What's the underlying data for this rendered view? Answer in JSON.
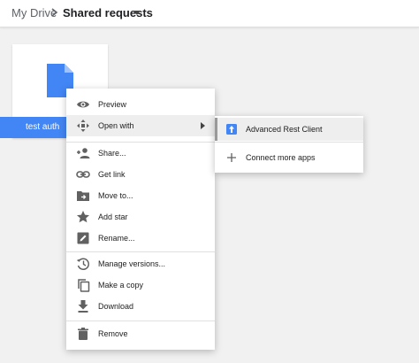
{
  "breadcrumb": {
    "root": "My Drive",
    "current": "Shared requests"
  },
  "file_tile": {
    "label": "test auth"
  },
  "context_menu": {
    "items": [
      {
        "label": "Preview",
        "icon": "eye-icon"
      },
      {
        "label": "Open with",
        "icon": "open-with-icon"
      },
      {
        "label": "Share...",
        "icon": "add-person-icon"
      },
      {
        "label": "Get link",
        "icon": "link-icon"
      },
      {
        "label": "Move to...",
        "icon": "move-folder-icon"
      },
      {
        "label": "Add star",
        "icon": "star-icon"
      },
      {
        "label": "Rename...",
        "icon": "pencil-icon"
      },
      {
        "label": "Manage versions...",
        "icon": "history-icon"
      },
      {
        "label": "Make a copy",
        "icon": "copy-icon"
      },
      {
        "label": "Download",
        "icon": "download-icon"
      },
      {
        "label": "Remove",
        "icon": "trash-icon"
      }
    ]
  },
  "open_with_submenu": {
    "items": [
      {
        "label": "Advanced Rest Client",
        "icon": "app-icon"
      },
      {
        "label": "Connect more apps",
        "icon": "plus-icon"
      }
    ]
  },
  "colors": {
    "accent": "#4285f4",
    "icon_gray": "#616161",
    "highlight": "#eeeeee"
  }
}
